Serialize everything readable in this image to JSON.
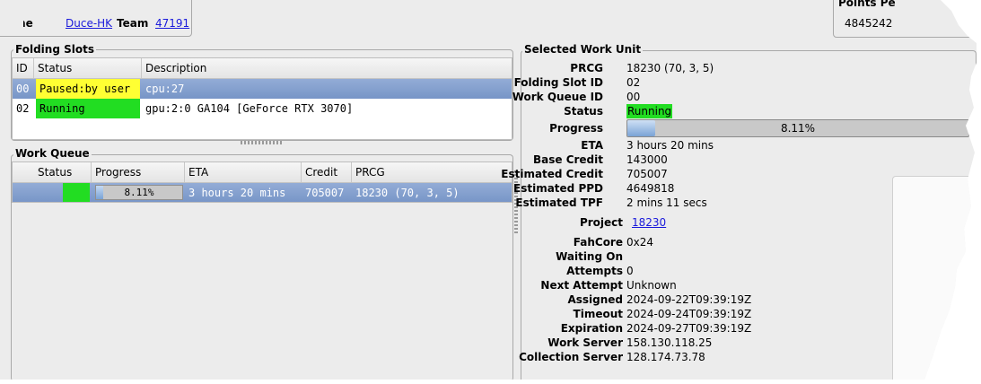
{
  "top": {
    "name_label": "Name",
    "name_value": "Duce-HK",
    "team_label": "Team",
    "team_value": "47191",
    "points_label": "Points Pe",
    "points_value": "4845242"
  },
  "folding_slots": {
    "title": "Folding Slots",
    "headers": [
      "ID",
      "Status",
      "Description"
    ],
    "rows": [
      {
        "id": "00",
        "status": "Paused:by user",
        "description": "cpu:27",
        "status_color": "#ffff33"
      },
      {
        "id": "02",
        "status": "Running",
        "description": "gpu:2:0 GA104 [GeForce RTX 3070]",
        "status_color": "#22dd22"
      }
    ]
  },
  "work_queue": {
    "title": "Work Queue",
    "headers": [
      "Status",
      "Progress",
      "ETA",
      "Credit",
      "PRCG"
    ],
    "rows": [
      {
        "progress": "8.11%",
        "progress_fraction": 0.0811,
        "eta": "3 hours 20 mins",
        "credit": "705007",
        "prcg": "18230 (70, 3, 5)"
      }
    ]
  },
  "selected": {
    "title": "Selected Work Unit",
    "prcg_label": "PRCG",
    "prcg": "18230 (70, 3, 5)",
    "slot_label": "Folding Slot ID",
    "slot": "02",
    "queue_label": "Work Queue ID",
    "queue": "00",
    "status_label": "Status",
    "status": "Running",
    "progress_label": "Progress",
    "progress": "8.11%",
    "progress_fraction": 0.0811,
    "eta_label": "ETA",
    "eta": "3 hours 20 mins",
    "base_credit_label": "Base Credit",
    "base_credit": "143000",
    "est_credit_label": "Estimated Credit",
    "est_credit": "705007",
    "est_ppd_label": "Estimated PPD",
    "est_ppd": "4649818",
    "est_tpf_label": "Estimated TPF",
    "est_tpf": "2 mins 11 secs",
    "project_label": "Project",
    "project": "18230",
    "fahcore_label": "FahCore",
    "fahcore": "0x24",
    "waiting_label": "Waiting On",
    "waiting": "",
    "attempts_label": "Attempts",
    "attempts": "0",
    "next_attempt_label": "Next Attempt",
    "next_attempt": "Unknown",
    "assigned_label": "Assigned",
    "assigned": "2024-09-22T09:39:19Z",
    "timeout_label": "Timeout",
    "timeout": "2024-09-24T09:39:19Z",
    "expiration_label": "Expiration",
    "expiration": "2024-09-27T09:39:19Z",
    "ws_label": "Work Server",
    "ws": "158.130.118.25",
    "cs_label": "Collection Server",
    "cs": "128.174.73.78"
  },
  "colors": {
    "running": "#22dd22",
    "paused": "#ffff33",
    "selection": "#7f9cca",
    "link": "#1a1adb"
  }
}
